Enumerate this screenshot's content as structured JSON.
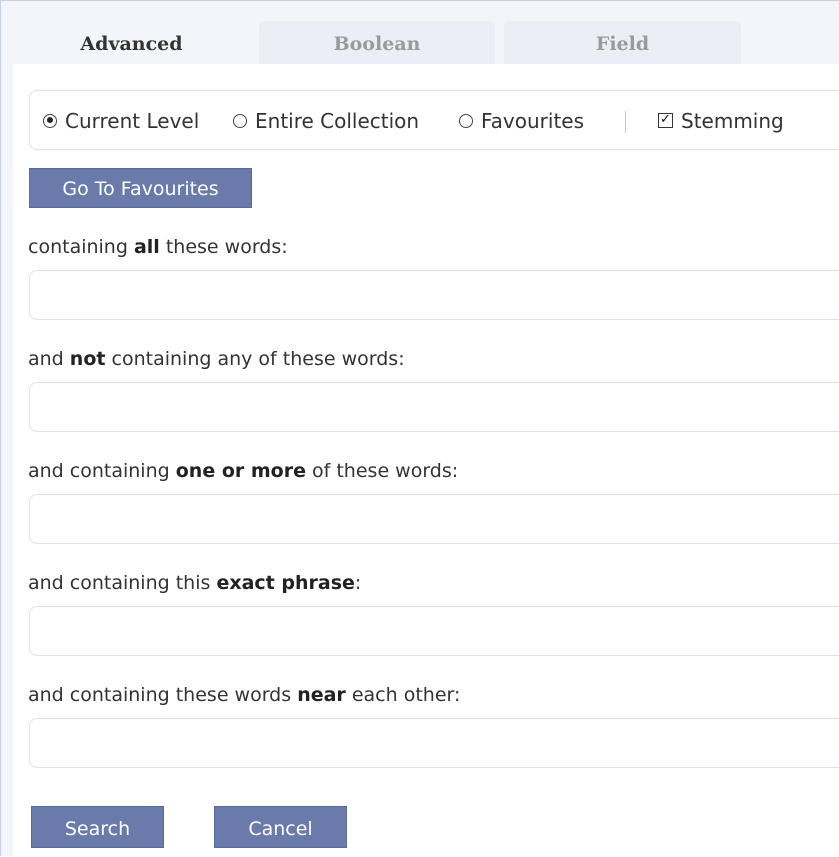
{
  "tabs": [
    {
      "label": "Advanced",
      "active": true
    },
    {
      "label": "Boolean",
      "active": false
    },
    {
      "label": "Field",
      "active": false
    }
  ],
  "scope": {
    "options": [
      {
        "label": "Current Level",
        "checked": true
      },
      {
        "label": "Entire Collection",
        "checked": false
      },
      {
        "label": "Favourites",
        "checked": false
      }
    ],
    "stemming": {
      "label": "Stemming",
      "checked": true
    }
  },
  "buttons": {
    "go_to_favourites": "Go To Favourites",
    "search": "Search",
    "cancel": "Cancel"
  },
  "fields": [
    {
      "pre": "containing ",
      "bold": "all",
      "post": " these words:",
      "value": ""
    },
    {
      "pre": "and ",
      "bold": "not",
      "post": " containing any of these words:",
      "value": ""
    },
    {
      "pre": "and containing ",
      "bold": "one or more",
      "post": " of these words:",
      "value": ""
    },
    {
      "pre": "and containing this ",
      "bold": "exact phrase",
      "post": ":",
      "value": ""
    },
    {
      "pre": "and containing these words ",
      "bold": "near",
      "post": " each other:",
      "value": ""
    }
  ],
  "colors": {
    "button_bg": "#6a7aaa",
    "page_bg": "#f3f5fa"
  }
}
